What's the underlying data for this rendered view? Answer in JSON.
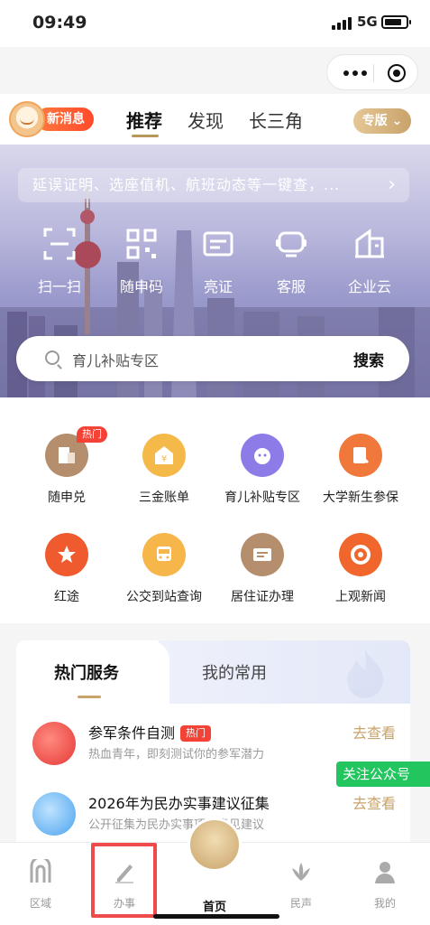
{
  "status_bar": {
    "time": "09:49",
    "network": "5G"
  },
  "header": {
    "new_message": "新消息",
    "tabs": [
      "推荐",
      "发现",
      "长三角"
    ],
    "edition": "专版"
  },
  "hero": {
    "notice": "延误证明、选座值机、航班动态等一键查，...",
    "quick_actions": [
      {
        "label": "扫一扫",
        "icon": "scan-icon"
      },
      {
        "label": "随申码",
        "icon": "qr-code-icon"
      },
      {
        "label": "亮证",
        "icon": "id-card-icon"
      },
      {
        "label": "客服",
        "icon": "customer-service-icon"
      },
      {
        "label": "企业云",
        "icon": "enterprise-cloud-icon"
      }
    ],
    "search": {
      "placeholder": "育儿补贴专区",
      "button": "搜索"
    }
  },
  "services": [
    {
      "label": "随申兑",
      "badge": "热门",
      "icon": "suishendui-icon",
      "color": "#b58e6d"
    },
    {
      "label": "三金账单",
      "icon": "fund-bill-icon",
      "color": "#f5b94a"
    },
    {
      "label": "育儿补贴专区",
      "icon": "childcare-subsidy-icon",
      "color": "#8d7be8"
    },
    {
      "label": "大学新生参保",
      "icon": "student-insurance-icon",
      "color": "#f0783a"
    },
    {
      "label": "红途",
      "icon": "red-route-icon",
      "color": "#ef5a2f"
    },
    {
      "label": "公交到站查询",
      "icon": "bus-icon",
      "color": "#f7b649"
    },
    {
      "label": "居住证办理",
      "icon": "residence-permit-icon",
      "color": "#b58e6d"
    },
    {
      "label": "上观新闻",
      "icon": "news-icon",
      "color": "#f0662c"
    }
  ],
  "hot_card": {
    "tabs": [
      "热门服务",
      "我的常用"
    ],
    "items": [
      {
        "title": "参军条件自测",
        "badge": "热门",
        "subtitle": "热血青年，即刻测试你的参军潜力",
        "action": "去查看",
        "icon": "military-flag-icon"
      },
      {
        "title": "2026年为民办实事建议征集",
        "subtitle": "公开征集为民办实事项目意见建议",
        "action": "去查看",
        "icon": "suggestion-icon"
      }
    ]
  },
  "follow_button": "关注公众号",
  "bottom_nav": [
    {
      "label": "区域",
      "icon": "region-icon"
    },
    {
      "label": "办事",
      "icon": "service-pen-icon"
    },
    {
      "label": "首页",
      "icon": "home-icon"
    },
    {
      "label": "民声",
      "icon": "voice-icon"
    },
    {
      "label": "我的",
      "icon": "profile-icon"
    }
  ],
  "colors": {
    "accent": "#c9a36a",
    "hot": "#f44336",
    "follow": "#22c55e",
    "highlight": "#ef4b4b"
  }
}
